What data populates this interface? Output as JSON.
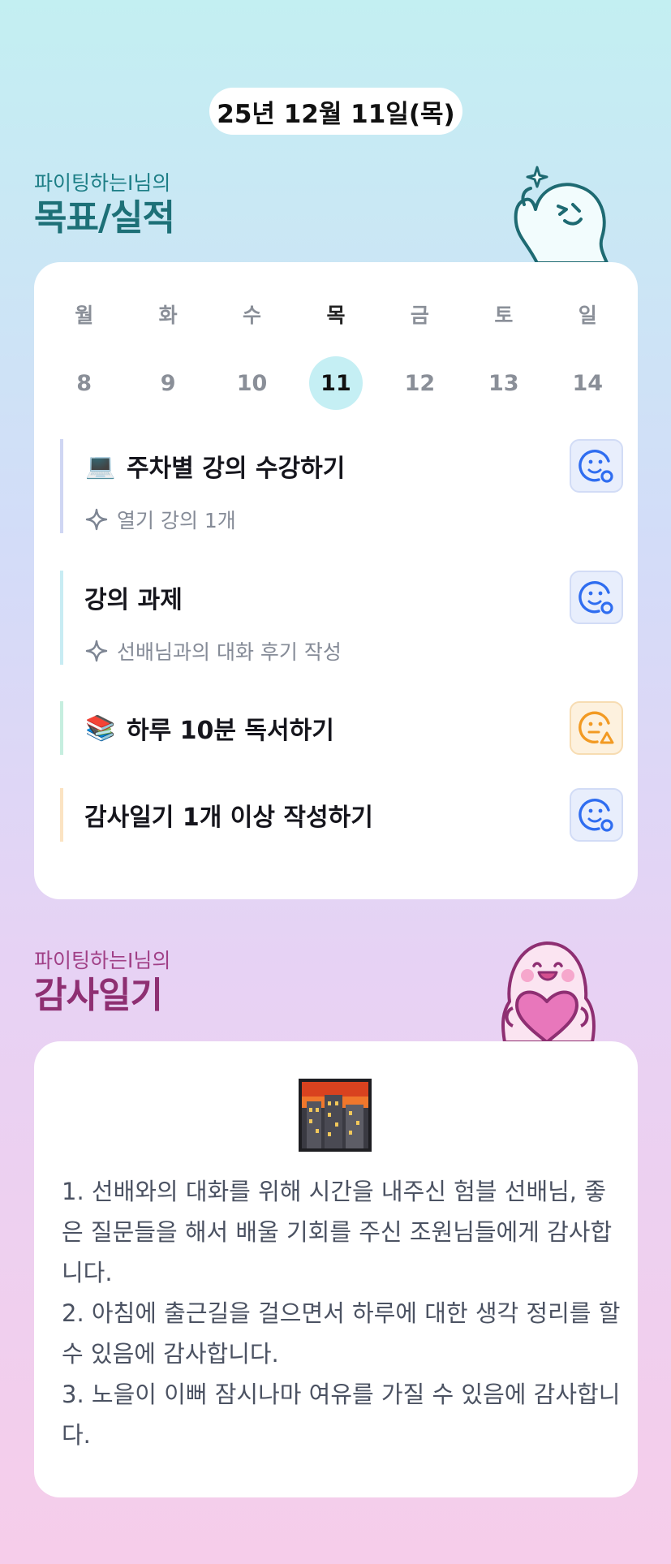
{
  "date": "25년 12월 11일(목)",
  "goals_section": {
    "subtitle": "파이팅하는I님의",
    "title": "목표/실적"
  },
  "week": {
    "days": [
      {
        "name": "월",
        "num": "8"
      },
      {
        "name": "화",
        "num": "9"
      },
      {
        "name": "수",
        "num": "10"
      },
      {
        "name": "목",
        "num": "11"
      },
      {
        "name": "금",
        "num": "12"
      },
      {
        "name": "토",
        "num": "13"
      },
      {
        "name": "일",
        "num": "14"
      }
    ],
    "selected_index": 3
  },
  "goals": [
    {
      "icon": "laptop-icon",
      "emoji": "💻",
      "text": "주차별 강의 수강하기",
      "detail": "열기 강의 1개",
      "status_icon": "smile-check-face-icon",
      "accent": "#cfd6f3"
    },
    {
      "icon": "",
      "emoji": "",
      "text": "강의 과제",
      "detail": "선배님과의 대화 후기 작성",
      "status_icon": "smile-check-face-icon",
      "accent": "#c8ecf3"
    },
    {
      "icon": "books-icon",
      "emoji": "📚",
      "text": "하루 10분 독서하기",
      "detail": "",
      "status_icon": "neutral-warning-face-icon",
      "accent": "#c6eedf"
    },
    {
      "icon": "",
      "emoji": "",
      "text": "감사일기 1개 이상 작성하기",
      "detail": "",
      "status_icon": "smile-check-face-icon",
      "accent": "#fbe3c2"
    }
  ],
  "diary_section": {
    "subtitle": "파이팅하는I님의",
    "title": "감사일기"
  },
  "diary": {
    "icon": "city-dusk-icon",
    "lines": [
      "1. 선배와의 대화를 위해 시간을 내주신 험블 선배님, 좋은 질문들을 해서 배울 기회를 주신 조원님들에게 감사합니다.",
      "2. 아침에 출근길을 걸으면서 하루에 대한 생각 정리를 할 수 있음에 감사합니다.",
      "3. 노을이 이뻐 잠시나마 여유를 가질 수 있음에 감사합니다."
    ]
  },
  "colors": {
    "goal_title": "#1d7077",
    "diary_title": "#8e2f72",
    "selected_day": "#c5eff4",
    "face_blue": "#2f6df0",
    "face_orange": "#f29a23"
  }
}
